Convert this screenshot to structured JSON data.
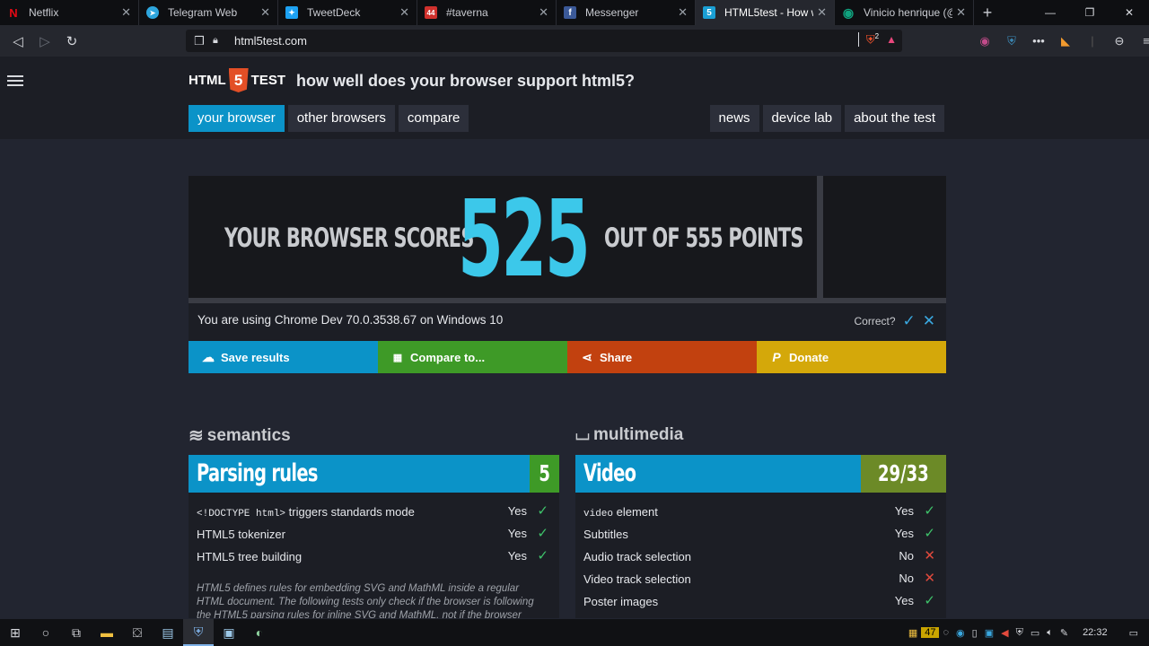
{
  "tabs": [
    {
      "title": "Netflix",
      "favicon": "N",
      "favicon_color": "#e50914",
      "active": false
    },
    {
      "title": "Telegram Web",
      "favicon": "➤",
      "favicon_color": "#2ea6de",
      "active": false
    },
    {
      "title": "TweetDeck",
      "favicon": "✦",
      "favicon_color": "#1da1f2",
      "active": false
    },
    {
      "title": "#taverna",
      "favicon": "44",
      "favicon_color": "#d0312d",
      "active": false
    },
    {
      "title": "Messenger",
      "favicon": "f",
      "favicon_color": "#3b5998",
      "active": false
    },
    {
      "title": "HTML5test - How w",
      "favicon": "5",
      "favicon_color": "#1a9fd4",
      "active": true
    },
    {
      "title": "Vinicio henrique (@",
      "favicon": "◉",
      "favicon_color": "#10a37f",
      "active": false
    }
  ],
  "address_bar": {
    "url": "html5test.com",
    "brave_badge": "2"
  },
  "site": {
    "logo_left": "HTML",
    "logo_num": "5",
    "logo_right": "TEST",
    "tagline": "how well does your browser support html5?",
    "nav_left": [
      "your browser",
      "other browsers",
      "compare"
    ],
    "nav_right": [
      "news",
      "device lab",
      "about the test"
    ]
  },
  "score": {
    "prefix": "YOUR BROWSER SCORES",
    "value": "525",
    "suffix": "OUT OF 555 POINTS"
  },
  "browser_info": {
    "text": "You are using Chrome Dev 70.0.3538.67 on Windows 10",
    "correct_label": "Correct?"
  },
  "actions": [
    {
      "label": "Save results",
      "icon": "cloud-upload-icon",
      "color": "#0b93c8"
    },
    {
      "label": "Compare to...",
      "icon": "grid-icon",
      "color": "#3e9a27"
    },
    {
      "label": "Share",
      "icon": "share-icon",
      "color": "#c2410f"
    },
    {
      "label": "Donate",
      "icon": "paypal-icon",
      "color": "#d4a80a"
    }
  ],
  "sections": {
    "semantics": {
      "title": "semantics",
      "category": "Parsing rules",
      "score": "5",
      "rows": [
        {
          "code": "<!DOCTYPE html>",
          "label": " triggers standards mode",
          "value": "Yes",
          "ok": true
        },
        {
          "code": "",
          "label": "HTML5 tokenizer",
          "value": "Yes",
          "ok": true
        },
        {
          "code": "",
          "label": "HTML5 tree building",
          "value": "Yes",
          "ok": true
        }
      ],
      "description": "HTML5 defines rules for embedding SVG and MathML inside a regular HTML document. The following tests only check if the browser is following the HTML5 parsing rules for inline SVG and MathML, not if the browser"
    },
    "multimedia": {
      "title": "multimedia",
      "category": "Video",
      "score": "29/33",
      "rows": [
        {
          "code": "video",
          "label": " element",
          "value": "Yes",
          "ok": true
        },
        {
          "code": "",
          "label": "Subtitles",
          "value": "Yes",
          "ok": true
        },
        {
          "code": "",
          "label": "Audio track selection",
          "value": "No",
          "ok": false
        },
        {
          "code": "",
          "label": "Video track selection",
          "value": "No",
          "ok": false
        },
        {
          "code": "",
          "label": "Poster images",
          "value": "Yes",
          "ok": true
        }
      ]
    }
  },
  "taskbar": {
    "time": "22:32",
    "badge": "47"
  }
}
